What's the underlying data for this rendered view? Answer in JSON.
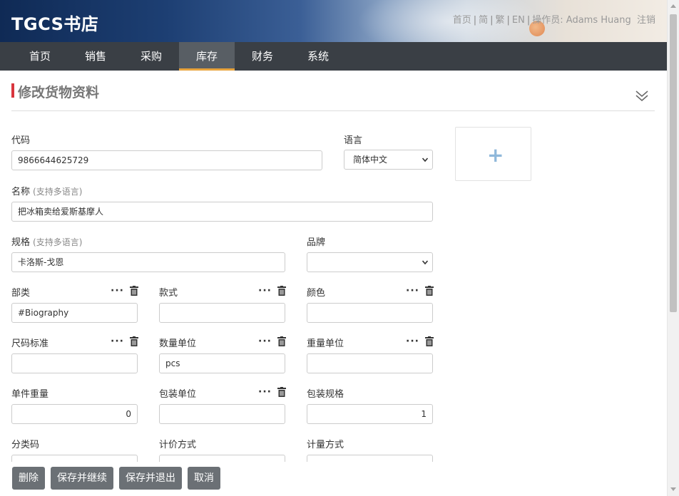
{
  "header": {
    "logo": "TGCS书店",
    "links": {
      "home": "首页",
      "simplified": "简",
      "traditional": "繁",
      "english": "EN",
      "operator_label": "操作员:",
      "operator_name": "Adams Huang",
      "logout": "注销"
    }
  },
  "nav": {
    "items": [
      "首页",
      "销售",
      "采购",
      "库存",
      "财务",
      "系统"
    ],
    "active": "库存"
  },
  "page": {
    "title": "修改货物资料"
  },
  "form": {
    "code": {
      "label": "代码",
      "value": "9866644625729"
    },
    "language": {
      "label": "语言",
      "value": "简体中文"
    },
    "name": {
      "label": "名称",
      "hint": "(支持多语言)",
      "value": "把冰箱卖给爱斯基摩人"
    },
    "spec": {
      "label": "规格",
      "hint": "(支持多语言)",
      "value": "卡洛斯-戈恩"
    },
    "brand": {
      "label": "品牌",
      "value": ""
    },
    "category": {
      "label": "部类",
      "value": "#Biography"
    },
    "style": {
      "label": "款式",
      "value": ""
    },
    "color": {
      "label": "颜色",
      "value": ""
    },
    "size_standard": {
      "label": "尺码标准",
      "value": ""
    },
    "quantity_unit": {
      "label": "数量单位",
      "value": "pcs"
    },
    "weight_unit": {
      "label": "重量单位",
      "value": ""
    },
    "unit_weight": {
      "label": "单件重量",
      "value": "0"
    },
    "package_unit": {
      "label": "包装单位",
      "value": ""
    },
    "package_spec": {
      "label": "包装规格",
      "value": "1"
    },
    "class_code": {
      "label": "分类码"
    },
    "pricing_method": {
      "label": "计价方式"
    },
    "measure_method": {
      "label": "计量方式"
    }
  },
  "buttons": {
    "delete": "删除",
    "save_continue": "保存并继续",
    "save_exit": "保存并退出",
    "cancel": "取消"
  },
  "colors": {
    "nav_bg": "#3a3f45",
    "active_tab": "#585e64",
    "active_underline": "#e8a33c",
    "title_bar": "#d9363e",
    "button_bg": "#6b7075"
  }
}
